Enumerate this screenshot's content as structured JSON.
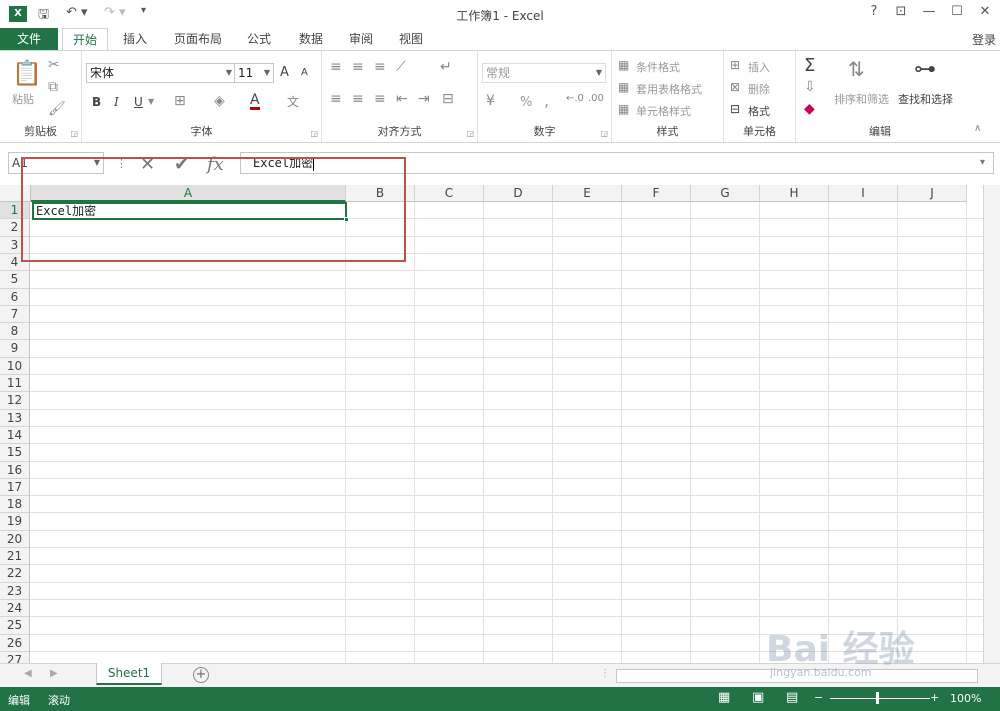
{
  "window": {
    "title": "工作簿1 - Excel",
    "app_icon_letter": "X",
    "help": "?",
    "controls": [
      "⊡",
      "—",
      "☐",
      "✕"
    ]
  },
  "tabs": {
    "file": "文件",
    "items": [
      "开始",
      "插入",
      "页面布局",
      "公式",
      "数据",
      "审阅",
      "视图"
    ],
    "active_index": 0,
    "login": "登录"
  },
  "ribbon": {
    "clipboard": {
      "label": "剪贴板",
      "paste": "粘贴"
    },
    "font": {
      "label": "字体",
      "name": "宋体",
      "size": "11",
      "bold": "B",
      "italic": "I",
      "underline": "U",
      "grow": "A",
      "shrink": "A",
      "color_letter": "A"
    },
    "alignment": {
      "label": "对齐方式"
    },
    "number": {
      "label": "数字",
      "format": "常规",
      "percent": "%",
      "comma": ","
    },
    "styles": {
      "label": "样式",
      "conditional": "条件格式",
      "table": "套用表格格式",
      "cell": "单元格样式"
    },
    "cells": {
      "label": "单元格",
      "insert": "插入",
      "delete": "删除",
      "format": "格式"
    },
    "editing": {
      "label": "编辑",
      "sort": "排序和筛选",
      "find": "查找和选择"
    }
  },
  "formula_bar": {
    "name_box": "A1",
    "value": "Excel加密"
  },
  "grid": {
    "columns": [
      "A",
      "B",
      "C",
      "D",
      "E",
      "F",
      "G",
      "H",
      "I",
      "J"
    ],
    "rows": [
      "1",
      "2",
      "3",
      "4",
      "5",
      "6",
      "7",
      "8",
      "9",
      "10",
      "11",
      "12",
      "13",
      "14",
      "15",
      "16",
      "17",
      "18",
      "19",
      "20",
      "21",
      "22",
      "23",
      "24",
      "25",
      "26",
      "27"
    ],
    "cell_a1": "Excel加密"
  },
  "sheets": {
    "active": "Sheet1",
    "add": "+"
  },
  "status": {
    "mode": "编辑",
    "scroll": "滚动",
    "zoom": "100%"
  },
  "watermark": {
    "logo": "Bai 经验",
    "url": "jingyan.baidu.com"
  }
}
